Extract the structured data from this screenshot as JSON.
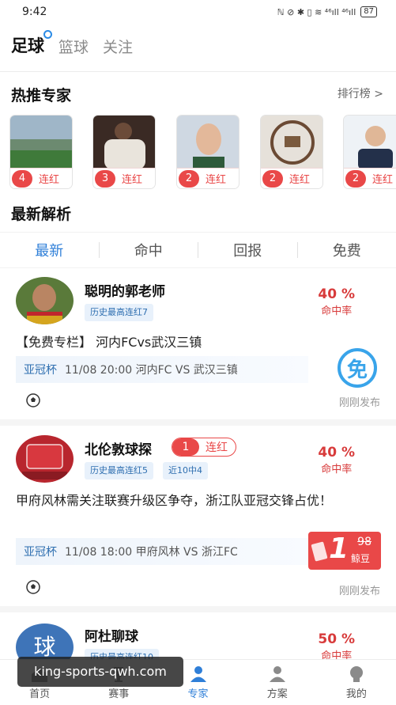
{
  "status": {
    "time": "9:42",
    "icons_text": "ℕ ⊘ ✱ ▯ ≋ ⁴⁶ıll ⁴⁶ıll",
    "battery": "87"
  },
  "top_tabs": [
    {
      "label": "足球",
      "active": true
    },
    {
      "label": "篮球",
      "active": false
    },
    {
      "label": "关注",
      "active": false
    }
  ],
  "hot_section": {
    "title": "热推专家",
    "rank_link": "排行榜 >"
  },
  "experts": [
    {
      "streak": "4",
      "label": "连红"
    },
    {
      "streak": "3",
      "label": "连红"
    },
    {
      "streak": "2",
      "label": "连红"
    },
    {
      "streak": "2",
      "label": "连红"
    },
    {
      "streak": "2",
      "label": "连红"
    }
  ],
  "latest_section": {
    "title": "最新解析"
  },
  "sub_tabs": [
    "最新",
    "命中",
    "回报",
    "免费"
  ],
  "posts": [
    {
      "author": "聪明的郭老师",
      "tags": [
        "历史最高连红7"
      ],
      "rate": "40 %",
      "rate_label": "命中率",
      "title": "【免费专栏】 河内FCvs武汉三镇",
      "league": "亚冠杯",
      "match": "11/08 20:00  河内FC VS 武汉三镇",
      "free_icon": "免",
      "time_ago": "刚刚发布"
    },
    {
      "author": "北伦敦球探",
      "streak": "1",
      "streak_label": "连红",
      "tags": [
        "历史最高连红5",
        "近10中4"
      ],
      "rate": "40 %",
      "rate_label": "命中率",
      "title": "甲府风林需关注联赛升级区争夺，浙江队亚冠交锋占优！",
      "league": "亚冠杯",
      "match": "11/08 18:00  甲府风林 VS 浙江FC",
      "price": "1",
      "old_price": "98",
      "price_unit": "鲸豆",
      "time_ago": "刚刚发布"
    },
    {
      "author": "阿杜聊球",
      "avatar_char": "球",
      "tags": [
        "历史最高连红10"
      ],
      "rate": "50 %",
      "rate_label": "命中率"
    }
  ],
  "bottom_nav": [
    {
      "label": "首页",
      "icon": "home-icon",
      "active": false
    },
    {
      "label": "赛事",
      "icon": "trophy-icon",
      "active": false
    },
    {
      "label": "专家",
      "icon": "expert-icon",
      "active": true
    },
    {
      "label": "方案",
      "icon": "plan-icon",
      "active": false
    },
    {
      "label": "我的",
      "icon": "profile-icon",
      "active": false
    }
  ],
  "watermark": "king-sports-qwh.com",
  "colors": {
    "accent_blue": "#2f7fd8",
    "accent_red": "#e94848"
  }
}
